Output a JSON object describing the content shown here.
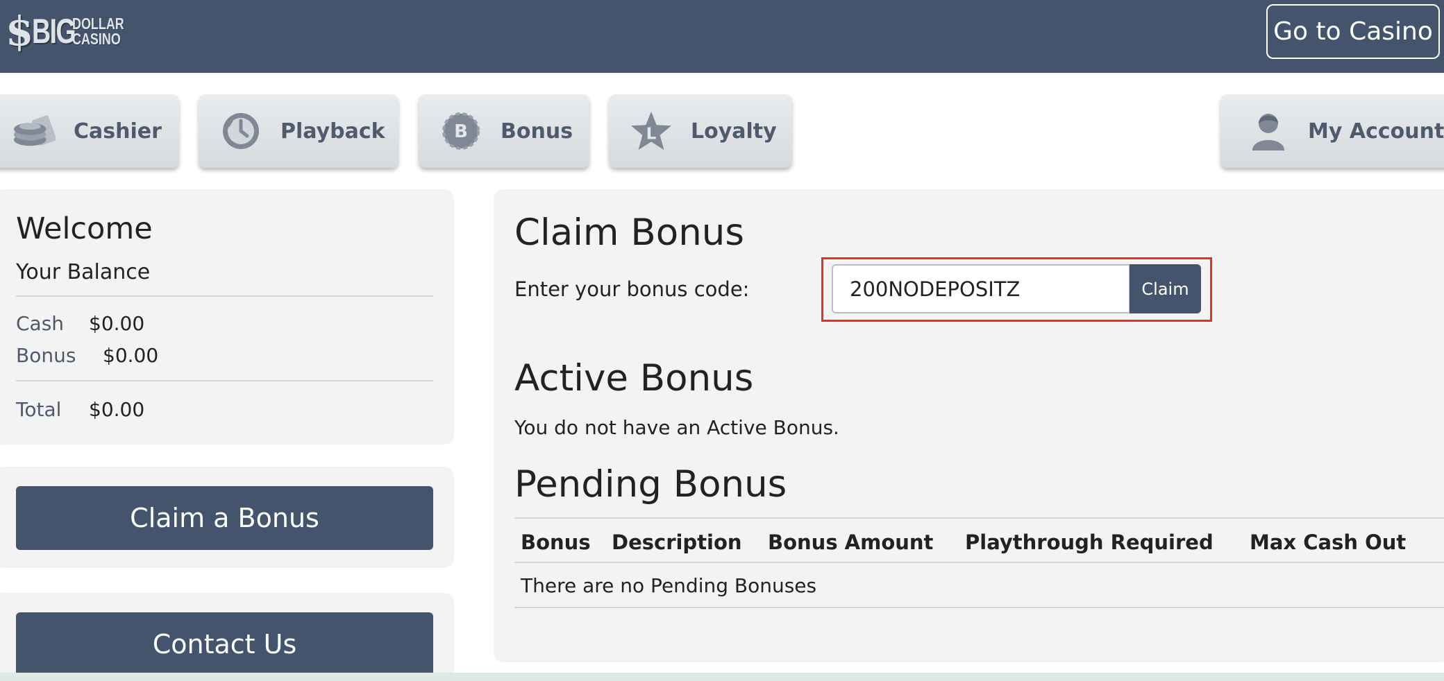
{
  "header": {
    "logo": {
      "symbol": "$",
      "big": "BIG",
      "line1": "DOLLAR",
      "line2": "CASINO"
    },
    "go_to_casino": "Go to Casino"
  },
  "nav": {
    "cashier": "Cashier",
    "playback": "Playback",
    "bonus": "Bonus",
    "bonus_icon_letter": "B",
    "loyalty": "Loyalty",
    "loyalty_icon_letter": "L",
    "my_account": "My Account"
  },
  "sidebar": {
    "welcome": "Welcome",
    "balance_title": "Your Balance",
    "cash_label": "Cash",
    "cash_value": "$0.00",
    "bonus_label": "Bonus",
    "bonus_value": "$0.00",
    "total_label": "Total",
    "total_value": "$0.00",
    "claim_bonus_button": "Claim a Bonus",
    "contact_us_button": "Contact Us"
  },
  "main": {
    "claim_title": "Claim Bonus",
    "code_label": "Enter your bonus code:",
    "code_value": "200NODEPOSITZ",
    "claim_button": "Claim",
    "active_title": "Active Bonus",
    "active_text": "You do not have an Active Bonus.",
    "pending_title": "Pending Bonus",
    "pending_table": {
      "columns": [
        "Bonus",
        "Description",
        "Bonus Amount",
        "Playthrough Required",
        "Max Cash Out"
      ],
      "empty_text": "There are no Pending Bonuses"
    }
  },
  "colors": {
    "header_bg": "#44546c",
    "button_bg": "#44546c",
    "highlight_border": "#e0321e",
    "panel_bg": "#f3f3f3"
  }
}
